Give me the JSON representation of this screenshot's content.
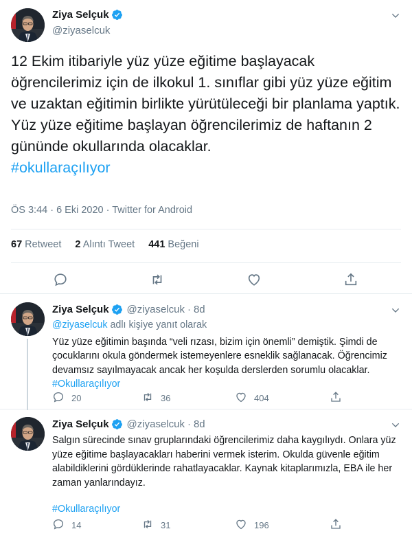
{
  "main_tweet": {
    "display_name": "Ziya Selçuk",
    "handle": "@ziyaselcuk",
    "text": "12 Ekim itibariyle yüz yüze eğitime başlayacak öğrencilerimiz için de ilkokul 1. sınıflar gibi yüz yüze eğitim ve uzaktan eğitimin birlikte yürütüleceği bir planlama yaptık. Yüz yüze eğitime başlayan öğrencilerimiz de haftanın 2 gününde okullarında olacaklar.",
    "hashtag": "#okullaraçılıyor",
    "meta": "ÖS 3:44 · 6 Eki 2020 · Twitter for Android",
    "retweets_count": "67",
    "retweets_label": "Retweet",
    "quotes_count": "2",
    "quotes_label": "Alıntı Tweet",
    "likes_count": "441",
    "likes_label": "Beğeni"
  },
  "replies": [
    {
      "display_name": "Ziya Selçuk",
      "handle": "@ziyaselcuk",
      "sep": "·",
      "time": "8d",
      "reply_to_handle": "@ziyaselcuk",
      "reply_to_suffix": " adlı kişiye yanıt olarak",
      "text": "Yüz yüze eğitimin başında “veli rızası, bizim için önemli” demiştik. Şimdi de çocuklarını okula göndermek istemeyenlere esneklik sağlanacak. Öğrencimiz devamsız sayılmayacak ancak her koşulda derslerden sorumlu olacaklar.",
      "hashtag": "#Okullaraçılıyor",
      "reply_count": "20",
      "retweet_count": "36",
      "like_count": "404"
    },
    {
      "display_name": "Ziya Selçuk",
      "handle": "@ziyaselcuk",
      "sep": "·",
      "time": "8d",
      "text": "Salgın sürecinde sınav gruplarındaki öğrencilerimiz daha kaygılıydı. Onlara yüz yüze eğitime başlayacakları haberini vermek isterim. Okulda güvenle eğitim alabildiklerini gördüklerinde rahatlayacaklar. Kaynak kitaplarımızla, EBA ile her zaman yanlarındayız.",
      "hashtag": "#Okullaraçılıyor",
      "reply_count": "14",
      "retweet_count": "31",
      "like_count": "196"
    }
  ],
  "colors": {
    "accent": "#1da1f2",
    "secondary_text": "#657786",
    "divider": "#e6ecf0"
  }
}
